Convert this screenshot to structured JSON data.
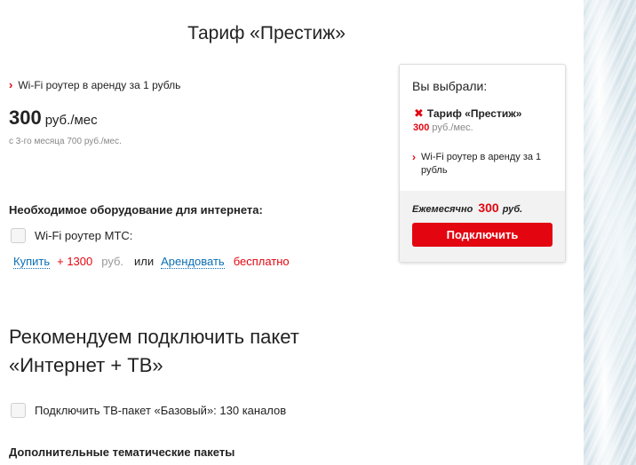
{
  "tariff": {
    "title": "Тариф «Престиж»",
    "feature": "Wi-Fi роутер в аренду за 1 рубль",
    "price_value": "300",
    "price_unit": "руб./мес",
    "price_note": "с 3-го месяца 700 руб./мес."
  },
  "equipment": {
    "heading": "Необходимое оборудование для интернета:",
    "router_label": "Wi-Fi роутер МТС:",
    "buy_link": "Купить",
    "buy_price": "+ 1300",
    "buy_unit": "руб.",
    "or_text": "или",
    "rent_link": "Арендовать",
    "rent_price": "бесплатно"
  },
  "recommend": {
    "line1": "Рекомендуем подключить пакет",
    "line2": "«Интернет + ТВ»",
    "tv_checkbox_label": "Подключить ТВ-пакет «Базовый»: 130 каналов",
    "extra_heading": "Дополнительные тематические пакеты"
  },
  "summary": {
    "title": "Вы выбрали:",
    "tariff_name": "Тариф «Престиж»",
    "tariff_price": "300",
    "tariff_price_unit": "руб./мес.",
    "feature": "Wi-Fi роутер в аренду за 1 рубль",
    "monthly_label": "Ежемесячно",
    "monthly_amount": "300",
    "monthly_unit": "руб.",
    "button_label": "Подключить"
  },
  "icons": {
    "bullet": "chevron-right-icon",
    "remove": "close-icon",
    "checkbox": "checkbox-unchecked"
  },
  "colors": {
    "accent": "#e30611",
    "link": "#0a6fb5"
  }
}
